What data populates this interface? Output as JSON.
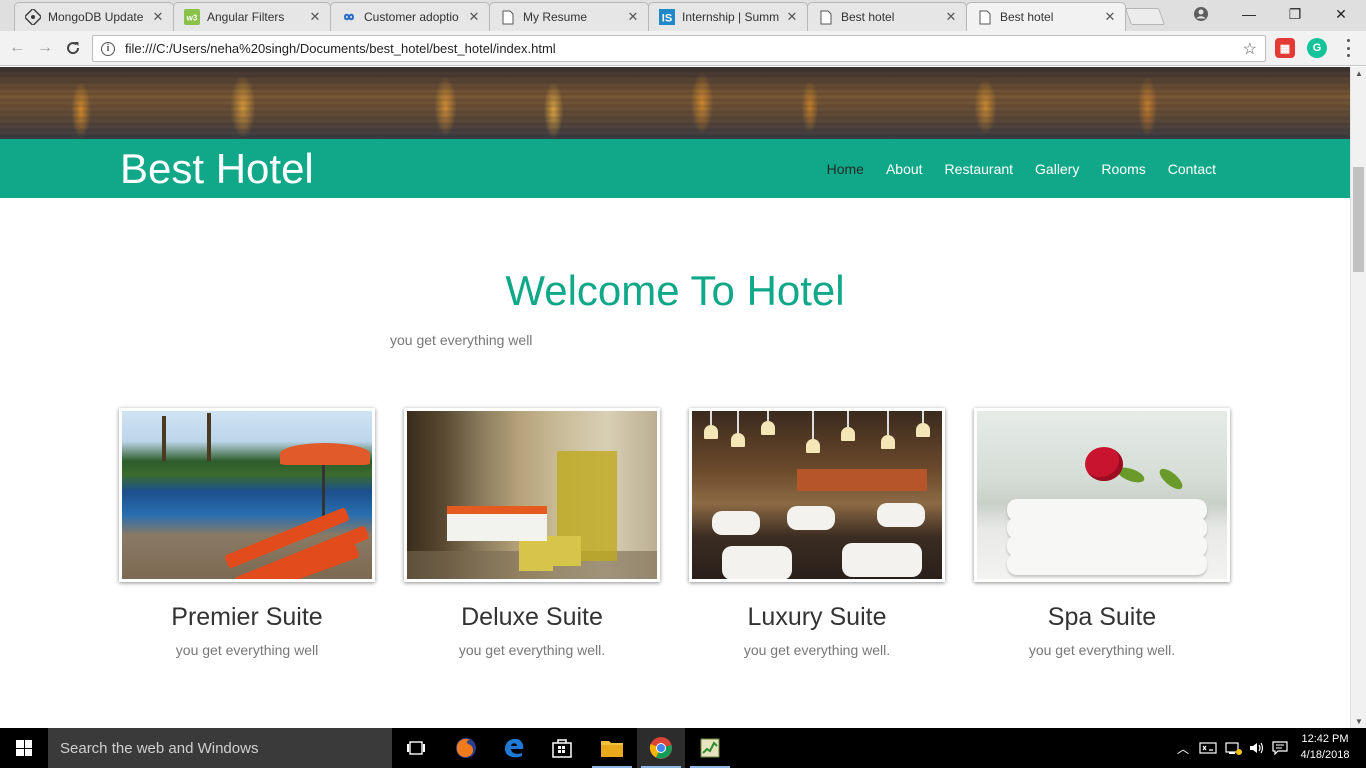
{
  "browser": {
    "tabs": [
      {
        "title": "MongoDB Update",
        "icon": "mongodb-icon"
      },
      {
        "title": "Angular Filters",
        "icon": "w3schools-icon"
      },
      {
        "title": "Customer adoptio",
        "icon": "infinity-icon"
      },
      {
        "title": "My Resume",
        "icon": "document-icon"
      },
      {
        "title": "Internship | Summ",
        "icon": "internshala-icon"
      },
      {
        "title": "Best hotel",
        "icon": "document-icon"
      },
      {
        "title": "Best hotel",
        "icon": "document-icon"
      }
    ],
    "active_tab": 6,
    "url": "file:///C:/Users/neha%20singh/Documents/best_hotel/best_hotel/index.html"
  },
  "site": {
    "brand": "Best Hotel",
    "nav": [
      "Home",
      "About",
      "Restaurant",
      "Gallery",
      "Rooms",
      "Contact"
    ],
    "nav_active": "Home",
    "accent_color": "#11a889",
    "welcome_title": "Welcome To Hotel",
    "welcome_tagline": "you get everything well",
    "suites": [
      {
        "name": "Premier Suite",
        "desc": "you get everything well"
      },
      {
        "name": "Deluxe Suite",
        "desc": "you get everything well."
      },
      {
        "name": "Luxury Suite",
        "desc": "you get everything well."
      },
      {
        "name": "Spa Suite",
        "desc": "you get everything well."
      }
    ]
  },
  "taskbar": {
    "search_placeholder": "Search the web and Windows",
    "time": "12:42 PM",
    "date": "4/18/2018"
  }
}
